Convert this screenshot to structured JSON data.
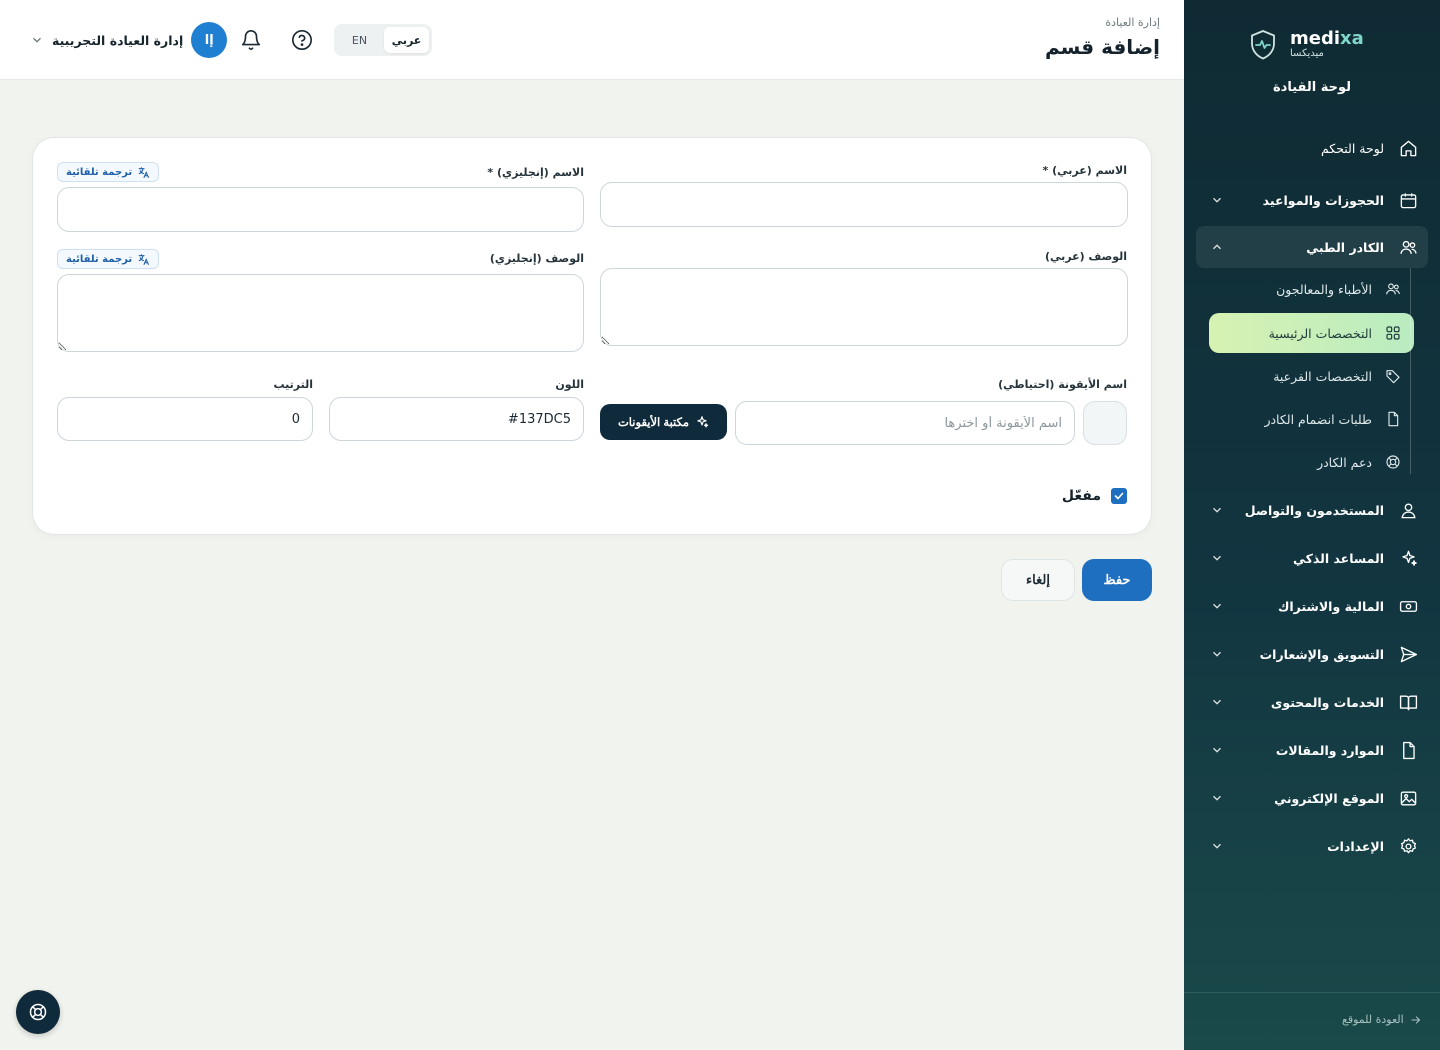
{
  "brand": {
    "name_main": "medi",
    "name_accent": "xa",
    "name_ar": "ميديكسا",
    "section": "لوحة القيادة"
  },
  "header": {
    "breadcrumb": "إدارة العيادة",
    "title": "إضافة قسم",
    "user_name": "إدارة العيادة التجريبية",
    "avatar_initials": "إا",
    "lang_ar": "عربي",
    "lang_en": "EN"
  },
  "sidebar": {
    "items": [
      {
        "label": "لوحة التحكم",
        "icon": "home-icon"
      },
      {
        "label": "الحجوزات والمواعيد",
        "icon": "calendar-icon"
      },
      {
        "label": "الكادر الطبي",
        "icon": "users-icon"
      },
      {
        "label": "المستخدمون والتواصل",
        "icon": "user-icon"
      },
      {
        "label": "المساعد الذكي",
        "icon": "sparkles-icon"
      },
      {
        "label": "المالية والاشتراك",
        "icon": "money-icon"
      },
      {
        "label": "التسويق والإشعارات",
        "icon": "send-icon"
      },
      {
        "label": "الخدمات والمحتوى",
        "icon": "book-icon"
      },
      {
        "label": "الموارد والمقالات",
        "icon": "file-icon"
      },
      {
        "label": "الموقع الإلكتروني",
        "icon": "image-icon"
      },
      {
        "label": "الإعدادات",
        "icon": "gear-icon"
      }
    ],
    "sub_items": [
      {
        "label": "الأطباء والمعالجون",
        "icon": "users-icon"
      },
      {
        "label": "التخصصات الرئيسية",
        "icon": "grid-icon",
        "active": true
      },
      {
        "label": "التخصصات الفرعية",
        "icon": "tag-icon"
      },
      {
        "label": "طلبات انضمام الكادر",
        "icon": "file-icon"
      },
      {
        "label": "دعم الكادر",
        "icon": "lifebuoy-icon"
      }
    ],
    "footer": "العودة للموقع"
  },
  "form": {
    "name_ar_label": "الاسم (عربي) *",
    "name_en_label": "الاسم (إنجليزي) *",
    "desc_ar_label": "الوصف (عربي)",
    "desc_en_label": "الوصف (إنجليزي)",
    "auto_translate": "ترجمة تلقائية",
    "icon_name_label": "اسم الأيقونة (احتياطي)",
    "icon_name_placeholder": "اسم الأيقونة أو اخترها",
    "icon_library_button": "مكتبة الأيقونات",
    "color_label": "اللون",
    "color_value": "#137DC5",
    "order_label": "الترتيب",
    "order_value": "0",
    "enabled_label": "مفعّل",
    "enabled": true
  },
  "actions": {
    "save": "حفظ",
    "cancel": "إلغاء"
  },
  "colors": {
    "primary": "#1f6fc1",
    "sidebar": "#0f2a33",
    "active_item": "#c9efb9"
  }
}
